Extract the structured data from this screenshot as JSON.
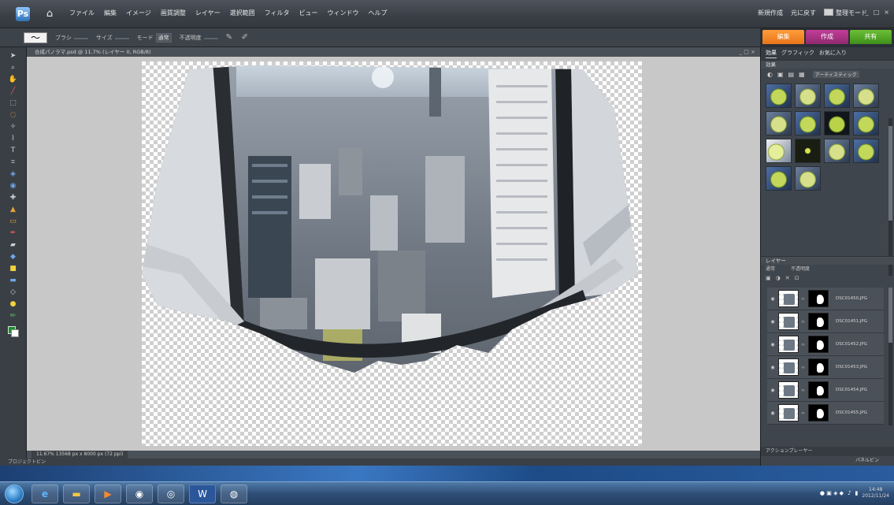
{
  "menubar": {
    "items": [
      "ファイル",
      "編集",
      "イメージ",
      "画質調整",
      "レイヤー",
      "選択範囲",
      "フィルタ",
      "ビュー",
      "ウィンドウ",
      "ヘルプ"
    ],
    "right_items": [
      "新規作成",
      "元に戻す",
      "整理モード"
    ]
  },
  "options": {
    "brush_label": "ブラシ",
    "size_label": "サイズ",
    "mode_label": "モード",
    "mode_value": "通常",
    "opacity_label": "不透明度"
  },
  "mode_tabs": {
    "edit": "編集",
    "create": "作成",
    "share": "共有"
  },
  "document": {
    "title": "合成パノラマ.psd @ 11.7% (レイヤー 0, RGB/8)"
  },
  "status": {
    "text": "11.67% 13568 px x 8000 px (72 ppi)"
  },
  "bins": {
    "project_bin": "プロジェクトビン"
  },
  "panels": {
    "tabs": [
      "効果",
      "グラフィック",
      "お気に入り"
    ],
    "effects_header": "効果",
    "effects_select": "アーティスティック",
    "layers_header": "レイヤー",
    "layer_mode": "通常",
    "layer_opacity_label": "不透明度",
    "layers": [
      {
        "name": "DSC01450.JPG"
      },
      {
        "name": "DSC01451.JPG"
      },
      {
        "name": "DSC01452.JPG"
      },
      {
        "name": "DSC01453.JPG"
      },
      {
        "name": "DSC01454.JPG"
      },
      {
        "name": "DSC01455.JPG"
      }
    ],
    "bottom_1": "アクションプレーヤー",
    "bottom_2": "パネルビン"
  },
  "taskbar": {
    "time": "14:48",
    "date": "2012/11/24"
  },
  "colors": {
    "edit_tab": "#e8741a",
    "create_tab": "#8f2a6f",
    "share_tab": "#3f8f1c",
    "foreground": "#1c8e2d",
    "background": "#ffffff"
  }
}
